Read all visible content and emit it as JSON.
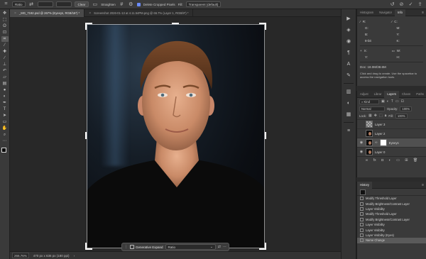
{
  "options_bar": {
    "tool_icon": "crop-icon",
    "ratio_label": "Ratio",
    "clear_label": "Clear",
    "straighten_label": "Straighten",
    "delete_cropped_label": "Delete Cropped Pixels",
    "fill_label": "Fill:",
    "fill_value": "Transparent (default)"
  },
  "tabs": [
    {
      "label": "_MG_7192.psd @ 267% (Eyeeys, RGB/16*) *",
      "active": true
    },
    {
      "label": "Screenshot 2026-01-13 at 4.11.54PM.png @ 66.7% (Layer 1, RGB/8*) *",
      "active": false
    }
  ],
  "toolbar": {
    "tools": [
      "move-icon",
      "marquee-icon",
      "lasso-icon",
      "object-select-icon",
      "crop-icon",
      "eyedropper-icon",
      "healing-icon",
      "brush-icon",
      "clone-stamp-icon",
      "history-brush-icon",
      "eraser-icon",
      "gradient-icon",
      "blur-icon",
      "dodge-icon",
      "pen-icon",
      "type-icon",
      "path-select-icon",
      "shape-icon",
      "hand-icon",
      "zoom-icon",
      "more-icon"
    ]
  },
  "taskbar": {
    "generative_expand_label": "Generative Expand",
    "ratio_label": "Ratio"
  },
  "status": {
    "zoom": "266.76%",
    "doc_info": "470 px x 636 px (180 ppi)"
  },
  "info_panel": {
    "tabs": [
      "Histogram",
      "Navigator",
      "Info"
    ],
    "active_tab": "Info",
    "r_label": "R:",
    "g_label": "G:",
    "b_label": "B:",
    "c_label": "C:",
    "m_label": "M:",
    "y_label": "Y:",
    "k_label": "K:",
    "bit_label": "8-bit",
    "x_label": "X:",
    "y2_label": "Y:",
    "w_label": "W:",
    "h_label": "H:",
    "doc_label": "Doc: 18.0M/38.6M",
    "hint": "Click and drag to create. Use the spacebar to access the navigation tools."
  },
  "layers_panel": {
    "tabs": [
      "Adjust",
      "Librar",
      "Layers",
      "Chann",
      "Paths"
    ],
    "active_tab": "Layers",
    "kind_label": "Kind",
    "blend_mode": "Normal",
    "opacity_label": "Opacity:",
    "opacity_value": "100%",
    "lock_label": "Lock:",
    "fill_label": "Fill:",
    "fill_value": "100%",
    "layers": [
      {
        "name": "Layer 3",
        "thumb": "blank",
        "selected": false,
        "mask": false
      },
      {
        "name": "Layer 2",
        "thumb": "face",
        "selected": false,
        "mask": false
      },
      {
        "name": "Eyeeys",
        "thumb": "face",
        "selected": true,
        "mask": true
      },
      {
        "name": "Layer 0",
        "thumb": "face",
        "selected": false,
        "mask": false
      }
    ]
  },
  "history_panel": {
    "tab": "History",
    "items": [
      "Modify Threshold Layer",
      "Modify Brightness/Contrast Layer",
      "Layer Visibility",
      "Modify Threshold Layer",
      "Modify Brightness/Contrast Layer",
      "Layer Visibility",
      "Layer Visibility",
      "Layer Visibility (Eyes)",
      "Name Change"
    ]
  }
}
